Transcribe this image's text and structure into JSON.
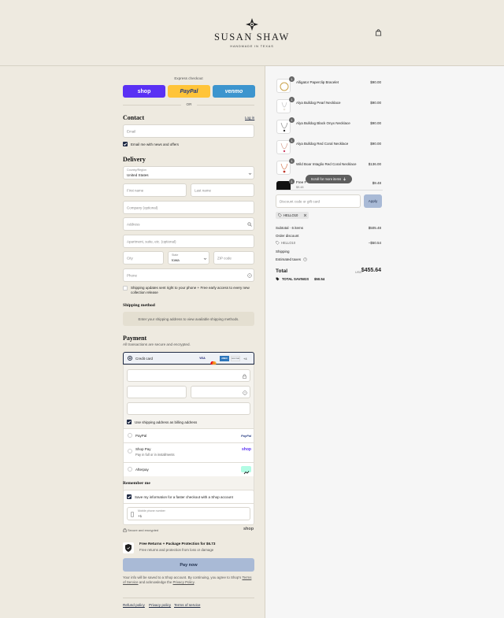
{
  "brand": {
    "name": "SUSAN SHAW",
    "tagline": "HANDMADE IN TEXAS"
  },
  "express": {
    "heading": "Express checkout",
    "shop_label": "shop",
    "paypal_label": "PayPal",
    "venmo_label": "venmo",
    "or_label": "OR",
    "colors": {
      "shop": "#5a31f4",
      "paypal": "#ffc439",
      "venmo": "#3d95ce"
    }
  },
  "contact": {
    "title": "Contact",
    "login_label": "Log in",
    "email_placeholder": "Email",
    "news_label": "Email me with news and offers"
  },
  "delivery": {
    "title": "Delivery",
    "country_label": "Country/Region",
    "country_value": "United States",
    "first_name": "First name",
    "last_name": "Last name",
    "company": "Company (optional)",
    "address": "Address",
    "apartment": "Apartment, suite, etc. (optional)",
    "city": "City",
    "state_label": "State",
    "state_value": "Iowa",
    "zip": "ZIP code",
    "phone": "Phone",
    "sms_label": "Shipping updates sent right to your phone + Free early access to every new collection release"
  },
  "shipping": {
    "title": "Shipping method",
    "notice": "Enter your shipping address to view available shipping methods."
  },
  "payment": {
    "title": "Payment",
    "subtitle": "All transactions are secure and encrypted.",
    "credit_card": "Credit card",
    "card_brands": [
      "VISA",
      "MC",
      "AMEX",
      "DISCOVER"
    ],
    "more_brands": "+4",
    "billing_label": "Use shipping address as billing address",
    "paypal": "PayPal",
    "paypal_logo": "PayPal",
    "shop_pay": "Shop Pay",
    "shop_pay_sub": "Pay in full or in installments",
    "shop_pay_logo": "shop",
    "afterpay": "Afterpay"
  },
  "remember": {
    "title": "Remember me",
    "save_label": "Save my information for a faster checkout with a Shop account",
    "mobile_label": "Mobile phone number",
    "mobile_value": "+1",
    "secure_label": "Secure and encrypted",
    "shop_logo": "shop"
  },
  "protection": {
    "title": "Free Returns + Package Protection for $6.73",
    "subtitle": "Free returns and protection from loss or damage"
  },
  "pay_now": "Pay now",
  "legal": {
    "text1": "Your info will be saved to a Shop account. By continuing, you agree to Shop's",
    "terms": "Terms of Service",
    "text2": "and acknowledge the",
    "privacy": "Privacy Policy",
    "end": "."
  },
  "footer": {
    "refund": "Refund policy",
    "privacy": "Privacy policy",
    "terms": "Terms of service"
  },
  "cart": {
    "items": [
      {
        "name": "Alligator Paperclip Bracelet",
        "price": "$90.00",
        "qty": "1"
      },
      {
        "name": "Alya Bulldog Pearl Necklace",
        "price": "$90.00",
        "qty": "1"
      },
      {
        "name": "Alya Bulldog Black Onyx Necklace",
        "price": "$90.00",
        "qty": "1"
      },
      {
        "name": "Alya Bulldog Red Coral Necklace",
        "price": "$90.00",
        "qty": "1"
      },
      {
        "name": "Wild Boar Intaglio Red Coral Necklace",
        "price": "$136.00",
        "qty": "1"
      },
      {
        "name": "Free F",
        "price": "$9.48",
        "qty": "1",
        "sub": "$9.48"
      }
    ],
    "scroll_hint": "Scroll for more items",
    "discount_placeholder": "Discount code or gift card",
    "apply": "Apply",
    "code_tag": "HELLO10",
    "subtotal_label": "Subtotal · 6 items",
    "subtotal_value": "$505.48",
    "order_discount_label": "Order discount",
    "order_discount_code": "HELLO10",
    "order_discount_value": "−$50.54",
    "shipping_label": "Shipping",
    "taxes_label": "Estimated taxes",
    "total_label": "Total",
    "currency": "USD",
    "total_value": "$455.64",
    "savings_label": "TOTAL SAVINGS",
    "savings_value": "$50.54"
  }
}
